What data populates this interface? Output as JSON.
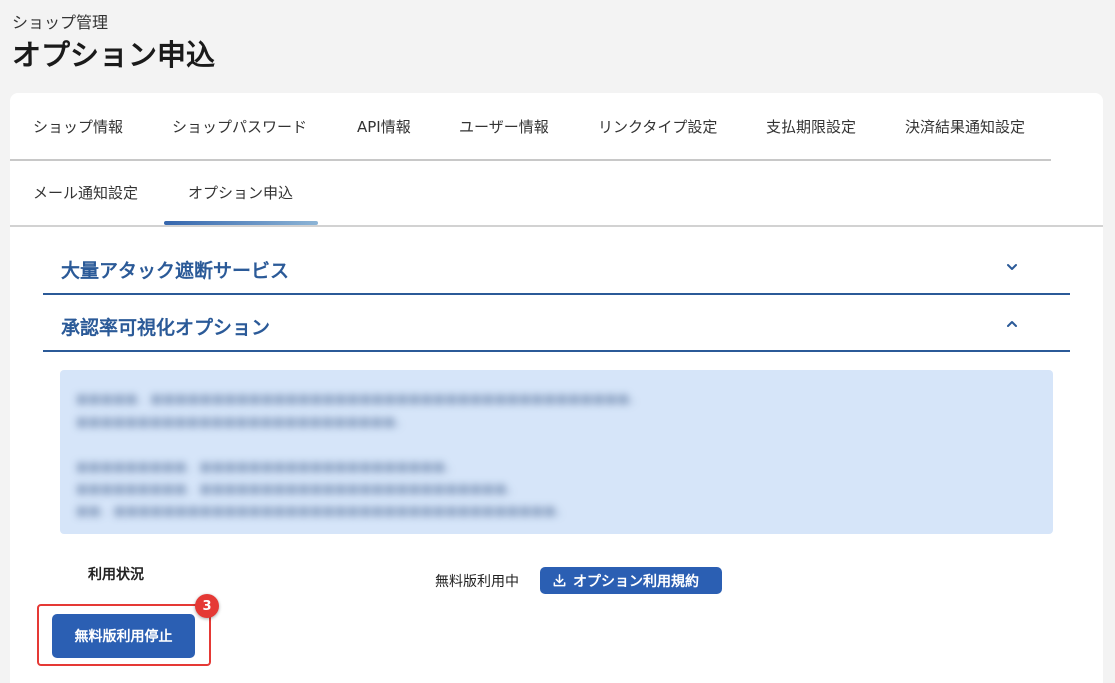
{
  "header": {
    "breadcrumb": "ショップ管理",
    "title": "オプション申込"
  },
  "tabs": [
    {
      "label": "ショップ情報"
    },
    {
      "label": "ショップパスワード"
    },
    {
      "label": "API情報"
    },
    {
      "label": "ユーザー情報"
    },
    {
      "label": "リンクタイプ設定"
    },
    {
      "label": "支払期限設定"
    },
    {
      "label": "決済結果通知設定"
    },
    {
      "label": "メール通知設定"
    },
    {
      "label": "オプション申込",
      "active": true
    }
  ],
  "accordions": [
    {
      "title": "大量アタック遮断サービス",
      "icon": "chevron-down-icon"
    },
    {
      "title": "承認率可視化オプション",
      "icon": "chevron-up-icon"
    }
  ],
  "usage": {
    "label": "利用状況",
    "value": "無料版利用中",
    "terms_button": "オプション利用規約",
    "stop_button": "無料版利用停止"
  },
  "annotation": {
    "step_badge": "3"
  },
  "colors": {
    "accent": "#2b5fb3",
    "heading": "#2b5a98",
    "info_background": "#d6e5f9",
    "highlight": "#e53935"
  }
}
